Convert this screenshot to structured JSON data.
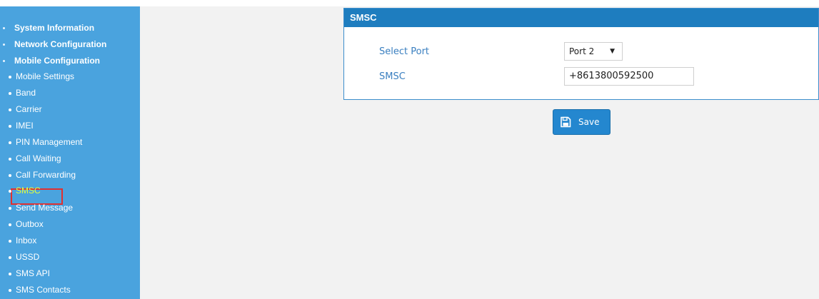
{
  "sidebar": {
    "top_items": [
      {
        "label": "System Information"
      },
      {
        "label": "Network Configuration"
      },
      {
        "label": "Mobile Configuration"
      }
    ],
    "sub_items": [
      {
        "label": "Mobile Settings"
      },
      {
        "label": "Band"
      },
      {
        "label": "Carrier"
      },
      {
        "label": "IMEI"
      },
      {
        "label": "PIN Management"
      },
      {
        "label": "Call Waiting"
      },
      {
        "label": "Call Forwarding"
      },
      {
        "label": "SMSC"
      },
      {
        "label": "Send Message"
      },
      {
        "label": "Outbox"
      },
      {
        "label": "Inbox"
      },
      {
        "label": "USSD"
      },
      {
        "label": "SMS API"
      },
      {
        "label": "SMS Contacts"
      }
    ],
    "active_item": "SMSC"
  },
  "panel": {
    "title": "SMSC",
    "select_port_label": "Select Port",
    "select_port_value": "Port 2",
    "smsc_label": "SMSC",
    "smsc_value": "+8613800592500"
  },
  "actions": {
    "save_label": "Save"
  },
  "colors": {
    "sidebar_bg": "#4aa3de",
    "header_bg": "#1e7dbf",
    "active_text": "#e4ff3a",
    "highlight_border": "#e03030",
    "button_bg": "#2487cf"
  },
  "icons": {
    "save": "floppy-disk-icon",
    "select_caret": "caret-down-icon",
    "nav_bullet": "bullet-icon"
  }
}
